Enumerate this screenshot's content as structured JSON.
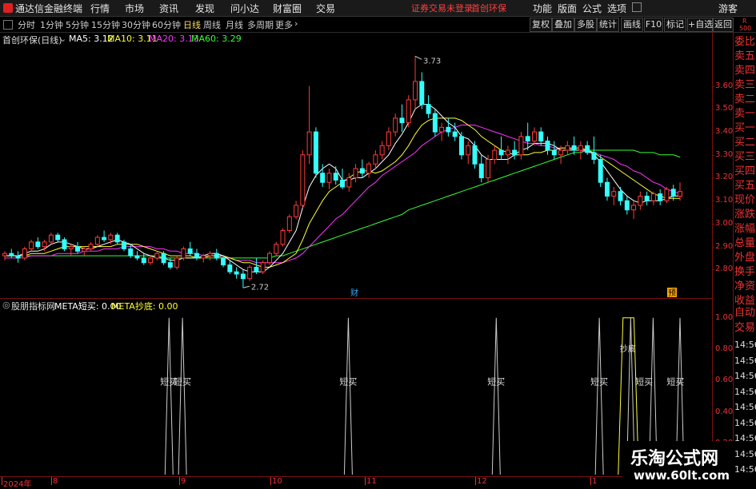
{
  "menubar": {
    "app_title": "通达信金融终端",
    "items": [
      "行情",
      "市场",
      "资讯",
      "发现",
      "问小达",
      "财富圈",
      "交易"
    ],
    "status": "证券交易未登录",
    "stock": "首创环保",
    "right_items": [
      "功能",
      "版面",
      "公式",
      "选项"
    ],
    "guest": "游客"
  },
  "toolbar": {
    "periods": [
      "分时",
      "1分钟",
      "5分钟",
      "15分钟",
      "30分钟",
      "60分钟",
      "日线",
      "周线",
      "月线",
      "多周期",
      "更多"
    ],
    "active_period": "日线",
    "right_buttons": [
      "复权",
      "叠加",
      "多股",
      "统计",
      "画线",
      "F10",
      "标记",
      "+自选",
      "返回"
    ]
  },
  "chart_header": {
    "name": "首创环保(日线)",
    "ma5": "MA5: 3.12",
    "ma10": "MA10: 3.11",
    "ma20": "MA20: 3.13",
    "ma60": "MA60: 3.29",
    "ma_colors": {
      "ma5": "#ffffff",
      "ma10": "#ffff33",
      "ma20": "#ff33ff",
      "ma60": "#33ff33"
    }
  },
  "indicator_header": {
    "name": "股朋指标网",
    "meta_buy": "META短买: 0.00",
    "meta_bottom": "META抄底: 0.00"
  },
  "right_panel": {
    "corner_top": "R",
    "corner_bottom": "500",
    "labels": [
      "委比",
      "卖五",
      "卖四",
      "卖三",
      "卖二",
      "卖一",
      "买一",
      "买二",
      "买三",
      "买四",
      "买五",
      "现价",
      "涨跌",
      "涨幅",
      "总量",
      "外盘",
      "换手",
      "净资",
      "收益",
      "自动",
      "交易"
    ],
    "times": [
      "14:56",
      "14:56",
      "14:56",
      "14:56",
      "14:56",
      "14:56",
      "14:56",
      "14:56",
      "14:56"
    ]
  },
  "chart_data": [
    {
      "type": "candlestick",
      "ylim": [
        2.7,
        3.78
      ],
      "yticks": [
        "3.60",
        "3.50",
        "3.40",
        "3.30",
        "3.20",
        "3.10",
        "3.00",
        "2.90",
        "2.80"
      ],
      "high_label": "3.73",
      "low_label": "2.72",
      "markers": [
        "财",
        "预"
      ],
      "x_labels": [
        "2024年",
        "8",
        "9",
        "10",
        "11",
        "12",
        "1"
      ],
      "colors": {
        "up": "#ff3b3b",
        "down": "#33ffff"
      },
      "ohlc": [
        [
          2.86,
          2.88,
          2.84,
          2.87
        ],
        [
          2.87,
          2.89,
          2.85,
          2.86
        ],
        [
          2.86,
          2.88,
          2.83,
          2.85
        ],
        [
          2.85,
          2.9,
          2.84,
          2.89
        ],
        [
          2.89,
          2.93,
          2.88,
          2.92
        ],
        [
          2.92,
          2.94,
          2.89,
          2.9
        ],
        [
          2.9,
          2.93,
          2.88,
          2.92
        ],
        [
          2.92,
          2.96,
          2.91,
          2.95
        ],
        [
          2.95,
          2.96,
          2.92,
          2.93
        ],
        [
          2.93,
          2.94,
          2.88,
          2.89
        ],
        [
          2.89,
          2.91,
          2.86,
          2.9
        ],
        [
          2.9,
          2.92,
          2.87,
          2.88
        ],
        [
          2.88,
          2.9,
          2.86,
          2.89
        ],
        [
          2.89,
          2.92,
          2.88,
          2.91
        ],
        [
          2.91,
          2.95,
          2.9,
          2.94
        ],
        [
          2.94,
          2.97,
          2.92,
          2.93
        ],
        [
          2.93,
          2.96,
          2.91,
          2.95
        ],
        [
          2.95,
          2.96,
          2.91,
          2.92
        ],
        [
          2.92,
          2.93,
          2.88,
          2.89
        ],
        [
          2.89,
          2.91,
          2.85,
          2.86
        ],
        [
          2.86,
          2.88,
          2.84,
          2.85
        ],
        [
          2.85,
          2.87,
          2.82,
          2.83
        ],
        [
          2.83,
          2.86,
          2.82,
          2.85
        ],
        [
          2.85,
          2.88,
          2.84,
          2.87
        ],
        [
          2.87,
          2.88,
          2.82,
          2.83
        ],
        [
          2.83,
          2.85,
          2.8,
          2.81
        ],
        [
          2.81,
          2.86,
          2.8,
          2.85
        ],
        [
          2.85,
          2.9,
          2.84,
          2.89
        ],
        [
          2.89,
          2.92,
          2.86,
          2.87
        ],
        [
          2.87,
          2.89,
          2.84,
          2.85
        ],
        [
          2.85,
          2.87,
          2.83,
          2.86
        ],
        [
          2.86,
          2.88,
          2.84,
          2.87
        ],
        [
          2.87,
          2.89,
          2.84,
          2.85
        ],
        [
          2.85,
          2.86,
          2.81,
          2.82
        ],
        [
          2.82,
          2.84,
          2.78,
          2.79
        ],
        [
          2.79,
          2.81,
          2.76,
          2.78
        ],
        [
          2.78,
          2.8,
          2.72,
          2.76
        ],
        [
          2.76,
          2.82,
          2.75,
          2.81
        ],
        [
          2.81,
          2.85,
          2.78,
          2.79
        ],
        [
          2.79,
          2.84,
          2.78,
          2.83
        ],
        [
          2.83,
          2.88,
          2.82,
          2.87
        ],
        [
          2.87,
          2.92,
          2.86,
          2.91
        ],
        [
          2.91,
          2.98,
          2.9,
          2.97
        ],
        [
          2.97,
          3.04,
          2.96,
          3.03
        ],
        [
          3.03,
          3.1,
          3.02,
          3.08
        ],
        [
          3.08,
          3.32,
          3.07,
          3.3
        ],
        [
          3.3,
          3.6,
          3.26,
          3.4
        ],
        [
          3.4,
          3.42,
          3.2,
          3.22
        ],
        [
          3.22,
          3.26,
          3.16,
          3.18
        ],
        [
          3.18,
          3.24,
          3.15,
          3.22
        ],
        [
          3.22,
          3.25,
          3.17,
          3.19
        ],
        [
          3.19,
          3.24,
          3.15,
          3.16
        ],
        [
          3.16,
          3.22,
          3.14,
          3.2
        ],
        [
          3.2,
          3.26,
          3.18,
          3.24
        ],
        [
          3.24,
          3.28,
          3.2,
          3.22
        ],
        [
          3.22,
          3.27,
          3.2,
          3.26
        ],
        [
          3.26,
          3.32,
          3.24,
          3.3
        ],
        [
          3.3,
          3.36,
          3.28,
          3.34
        ],
        [
          3.34,
          3.42,
          3.32,
          3.4
        ],
        [
          3.4,
          3.48,
          3.38,
          3.46
        ],
        [
          3.46,
          3.52,
          3.4,
          3.44
        ],
        [
          3.44,
          3.56,
          3.42,
          3.54
        ],
        [
          3.54,
          3.73,
          3.5,
          3.62
        ],
        [
          3.62,
          3.66,
          3.5,
          3.52
        ],
        [
          3.52,
          3.56,
          3.46,
          3.48
        ],
        [
          3.48,
          3.5,
          3.38,
          3.4
        ],
        [
          3.4,
          3.44,
          3.36,
          3.42
        ],
        [
          3.42,
          3.46,
          3.38,
          3.4
        ],
        [
          3.4,
          3.44,
          3.36,
          3.38
        ],
        [
          3.38,
          3.4,
          3.28,
          3.3
        ],
        [
          3.3,
          3.36,
          3.26,
          3.34
        ],
        [
          3.34,
          3.36,
          3.24,
          3.26
        ],
        [
          3.26,
          3.3,
          3.18,
          3.2
        ],
        [
          3.2,
          3.3,
          3.18,
          3.28
        ],
        [
          3.28,
          3.34,
          3.26,
          3.32
        ],
        [
          3.32,
          3.38,
          3.28,
          3.3
        ],
        [
          3.3,
          3.34,
          3.26,
          3.32
        ],
        [
          3.32,
          3.36,
          3.28,
          3.3
        ],
        [
          3.3,
          3.4,
          3.28,
          3.38
        ],
        [
          3.38,
          3.44,
          3.32,
          3.36
        ],
        [
          3.36,
          3.42,
          3.34,
          3.4
        ],
        [
          3.4,
          3.42,
          3.34,
          3.36
        ],
        [
          3.36,
          3.38,
          3.3,
          3.32
        ],
        [
          3.32,
          3.36,
          3.28,
          3.3
        ],
        [
          3.3,
          3.34,
          3.26,
          3.32
        ],
        [
          3.32,
          3.36,
          3.3,
          3.34
        ],
        [
          3.34,
          3.38,
          3.3,
          3.32
        ],
        [
          3.32,
          3.36,
          3.28,
          3.34
        ],
        [
          3.34,
          3.36,
          3.3,
          3.31
        ],
        [
          3.31,
          3.38,
          3.26,
          3.28
        ],
        [
          3.28,
          3.3,
          3.16,
          3.18
        ],
        [
          3.18,
          3.2,
          3.1,
          3.12
        ],
        [
          3.12,
          3.16,
          3.08,
          3.14
        ],
        [
          3.14,
          3.16,
          3.08,
          3.1
        ],
        [
          3.1,
          3.12,
          3.04,
          3.06
        ],
        [
          3.06,
          3.1,
          3.02,
          3.08
        ],
        [
          3.08,
          3.14,
          3.06,
          3.12
        ],
        [
          3.12,
          3.14,
          3.08,
          3.1
        ],
        [
          3.1,
          3.14,
          3.08,
          3.13
        ],
        [
          3.13,
          3.15,
          3.08,
          3.1
        ],
        [
          3.1,
          3.16,
          3.09,
          3.15
        ],
        [
          3.15,
          3.17,
          3.1,
          3.12
        ],
        [
          3.12,
          3.18,
          3.1,
          3.14
        ]
      ],
      "ma5": [
        2.86,
        2.86,
        2.86,
        2.87,
        2.88,
        2.88,
        2.89,
        2.91,
        2.92,
        2.92,
        2.91,
        2.9,
        2.89,
        2.89,
        2.9,
        2.91,
        2.92,
        2.93,
        2.92,
        2.91,
        2.89,
        2.87,
        2.86,
        2.85,
        2.85,
        2.84,
        2.84,
        2.85,
        2.85,
        2.85,
        2.86,
        2.87,
        2.87,
        2.86,
        2.84,
        2.82,
        2.8,
        2.79,
        2.79,
        2.79,
        2.81,
        2.84,
        2.87,
        2.92,
        2.97,
        3.07,
        3.16,
        3.21,
        3.24,
        3.26,
        3.24,
        3.19,
        3.19,
        3.2,
        3.2,
        3.22,
        3.24,
        3.27,
        3.3,
        3.35,
        3.39,
        3.44,
        3.5,
        3.52,
        3.52,
        3.5,
        3.47,
        3.44,
        3.42,
        3.38,
        3.37,
        3.34,
        3.3,
        3.28,
        3.28,
        3.28,
        3.28,
        3.3,
        3.32,
        3.33,
        3.35,
        3.35,
        3.35,
        3.34,
        3.32,
        3.32,
        3.32,
        3.32,
        3.32,
        3.3,
        3.27,
        3.23,
        3.19,
        3.15,
        3.12,
        3.1,
        3.09,
        3.1,
        3.1,
        3.1,
        3.11,
        3.12,
        3.12
      ],
      "ma10": [
        2.86,
        2.86,
        2.86,
        2.86,
        2.87,
        2.87,
        2.87,
        2.88,
        2.89,
        2.9,
        2.9,
        2.9,
        2.9,
        2.9,
        2.9,
        2.9,
        2.9,
        2.91,
        2.91,
        2.91,
        2.91,
        2.9,
        2.89,
        2.88,
        2.87,
        2.86,
        2.86,
        2.86,
        2.86,
        2.85,
        2.85,
        2.86,
        2.86,
        2.86,
        2.85,
        2.84,
        2.83,
        2.83,
        2.82,
        2.81,
        2.81,
        2.82,
        2.83,
        2.85,
        2.87,
        2.93,
        3.0,
        3.05,
        3.1,
        3.14,
        3.16,
        3.18,
        3.2,
        3.22,
        3.23,
        3.23,
        3.22,
        3.23,
        3.25,
        3.27,
        3.3,
        3.34,
        3.39,
        3.43,
        3.45,
        3.46,
        3.46,
        3.46,
        3.46,
        3.45,
        3.43,
        3.41,
        3.38,
        3.36,
        3.34,
        3.32,
        3.31,
        3.3,
        3.3,
        3.3,
        3.31,
        3.31,
        3.32,
        3.32,
        3.33,
        3.33,
        3.33,
        3.33,
        3.32,
        3.31,
        3.29,
        3.27,
        3.25,
        3.23,
        3.21,
        3.19,
        3.17,
        3.15,
        3.13,
        3.12,
        3.11,
        3.11,
        3.11
      ],
      "ma20": [
        2.85,
        2.85,
        2.85,
        2.85,
        2.86,
        2.86,
        2.86,
        2.86,
        2.87,
        2.87,
        2.87,
        2.87,
        2.88,
        2.88,
        2.88,
        2.89,
        2.89,
        2.89,
        2.9,
        2.9,
        2.9,
        2.9,
        2.9,
        2.89,
        2.89,
        2.88,
        2.88,
        2.87,
        2.87,
        2.87,
        2.86,
        2.86,
        2.86,
        2.85,
        2.85,
        2.84,
        2.84,
        2.84,
        2.83,
        2.83,
        2.83,
        2.83,
        2.83,
        2.84,
        2.85,
        2.87,
        2.9,
        2.93,
        2.96,
        2.99,
        3.02,
        3.04,
        3.07,
        3.1,
        3.13,
        3.16,
        3.18,
        3.21,
        3.23,
        3.25,
        3.27,
        3.29,
        3.31,
        3.34,
        3.36,
        3.38,
        3.4,
        3.41,
        3.42,
        3.43,
        3.43,
        3.43,
        3.42,
        3.41,
        3.4,
        3.39,
        3.38,
        3.37,
        3.36,
        3.35,
        3.35,
        3.34,
        3.34,
        3.33,
        3.33,
        3.33,
        3.32,
        3.32,
        3.31,
        3.31,
        3.3,
        3.29,
        3.28,
        3.26,
        3.25,
        3.23,
        3.22,
        3.2,
        3.18,
        3.17,
        3.15,
        3.14,
        3.13
      ],
      "ma60": [
        2.86,
        2.86,
        2.86,
        2.86,
        2.86,
        2.86,
        2.86,
        2.86,
        2.86,
        2.86,
        2.86,
        2.86,
        2.86,
        2.86,
        2.86,
        2.86,
        2.86,
        2.86,
        2.86,
        2.86,
        2.86,
        2.86,
        2.86,
        2.86,
        2.85,
        2.85,
        2.85,
        2.85,
        2.85,
        2.85,
        2.85,
        2.85,
        2.85,
        2.85,
        2.85,
        2.85,
        2.85,
        2.85,
        2.85,
        2.85,
        2.85,
        2.86,
        2.86,
        2.87,
        2.88,
        2.89,
        2.9,
        2.91,
        2.92,
        2.93,
        2.94,
        2.95,
        2.96,
        2.97,
        2.98,
        2.99,
        3.0,
        3.01,
        3.02,
        3.03,
        3.04,
        3.06,
        3.07,
        3.08,
        3.09,
        3.1,
        3.11,
        3.12,
        3.13,
        3.14,
        3.15,
        3.16,
        3.17,
        3.18,
        3.19,
        3.2,
        3.21,
        3.22,
        3.23,
        3.24,
        3.25,
        3.26,
        3.27,
        3.28,
        3.29,
        3.3,
        3.31,
        3.31,
        3.32,
        3.32,
        3.32,
        3.32,
        3.32,
        3.32,
        3.32,
        3.32,
        3.31,
        3.31,
        3.31,
        3.3,
        3.3,
        3.3,
        3.29
      ]
    },
    {
      "type": "line",
      "ylim": [
        0,
        1.0
      ],
      "yticks": [
        "1.00",
        "0.80",
        "0.60",
        "0.40",
        "0.20"
      ],
      "spike_bars": [
        37,
        40,
        77,
        110,
        133,
        140,
        145,
        151
      ],
      "plateau": [
        139,
        140
      ],
      "buy_labels": [
        {
          "bar": 37,
          "text": "短买"
        },
        {
          "bar": 40,
          "text": "短买"
        },
        {
          "bar": 77,
          "text": "短买"
        },
        {
          "bar": 110,
          "text": "短买"
        },
        {
          "bar": 133,
          "text": "短买"
        },
        {
          "bar": 143,
          "text": "短买"
        },
        {
          "bar": 150,
          "text": "短买"
        }
      ],
      "bottom_label": {
        "bar": 139,
        "text": "抄底"
      }
    }
  ],
  "watermark": {
    "title": "乐淘公式网",
    "url": "www.60lt.com"
  }
}
